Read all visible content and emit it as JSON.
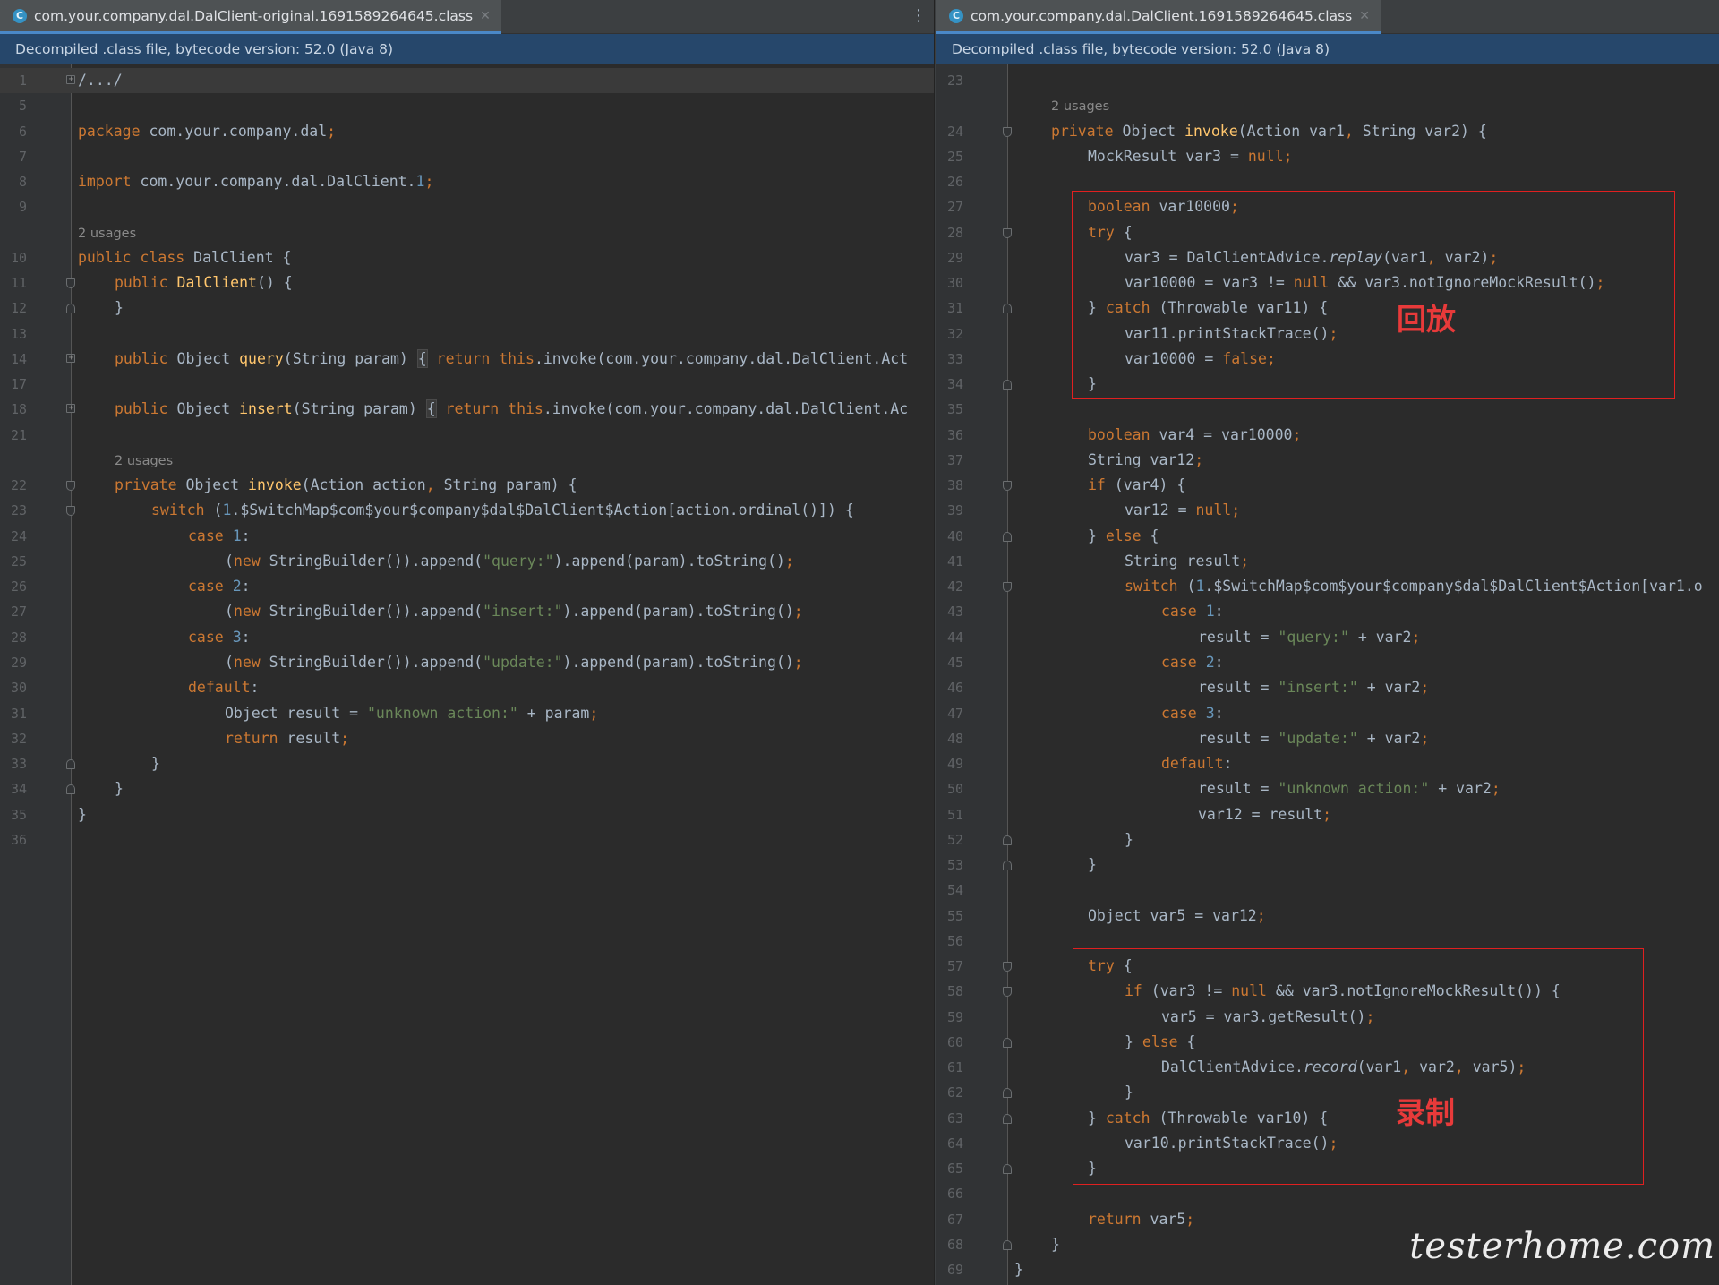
{
  "left": {
    "tab": {
      "title": "com.your.company.dal.DalClient-original.1691589264645.class",
      "icon": "C"
    },
    "banner": "Decompiled .class file, bytecode version: 52.0 (Java 8)"
  },
  "right": {
    "tab": {
      "title": "com.your.company.dal.DalClient.1691589264645.class",
      "icon": "C"
    },
    "banner": "Decompiled .class file, bytecode version: 52.0 (Java 8)"
  },
  "annotations": {
    "replay": "回放",
    "record": "录制"
  },
  "watermark": "testerhome.com",
  "colors": {
    "keyword": "#cc7832",
    "string": "#6a8759",
    "number": "#6897bb",
    "method": "#ffc66d",
    "annotation_box": "#e02020"
  },
  "icons": {
    "tab_icon": "class-icon",
    "close": "close-icon",
    "menu": "more-vertical-icon",
    "fold": "fold-marker-icon"
  },
  "left_lines": [
    {
      "n": "1",
      "indent": 0,
      "fold": "plus",
      "tokens": [
        [
          "",
          "/.../"
        ]
      ]
    },
    {
      "n": "5",
      "indent": 0,
      "tokens": []
    },
    {
      "n": "6",
      "indent": 0,
      "tokens": [
        [
          "kw",
          "package"
        ],
        [
          "plain",
          " com.your.company.dal"
        ],
        [
          "kw",
          ";"
        ]
      ]
    },
    {
      "n": "7",
      "indent": 0,
      "tokens": []
    },
    {
      "n": "8",
      "indent": 0,
      "tokens": [
        [
          "kw",
          "import"
        ],
        [
          "plain",
          " com.your.company.dal.DalClient."
        ],
        [
          "num",
          "1"
        ],
        [
          "kw",
          ";"
        ]
      ]
    },
    {
      "n": "9",
      "indent": 0,
      "tokens": []
    },
    {
      "n": "",
      "indent": 0,
      "hint": "2 usages"
    },
    {
      "n": "10",
      "indent": 0,
      "tokens": [
        [
          "kw",
          "public class"
        ],
        [
          "plain",
          " DalClient {"
        ]
      ]
    },
    {
      "n": "11",
      "indent": 1,
      "fold": "start",
      "tokens": [
        [
          "kw",
          "public"
        ],
        [
          "plain",
          " "
        ],
        [
          "fn",
          "DalClient"
        ],
        [
          "plain",
          "() {"
        ]
      ]
    },
    {
      "n": "12",
      "indent": 1,
      "fold": "end",
      "tokens": [
        [
          "plain",
          "}"
        ]
      ]
    },
    {
      "n": "13",
      "indent": 0,
      "tokens": []
    },
    {
      "n": "14",
      "indent": 1,
      "fold": "plus",
      "tokens": [
        [
          "kw",
          "public"
        ],
        [
          "plain",
          " Object "
        ],
        [
          "fn",
          "query"
        ],
        [
          "plain",
          "(String param) "
        ],
        [
          "box",
          "{"
        ],
        [
          "plain",
          " "
        ],
        [
          "kw",
          "return this"
        ],
        [
          "plain",
          ".invoke(com.your.company.dal.DalClient.Act"
        ]
      ]
    },
    {
      "n": "17",
      "indent": 0,
      "tokens": []
    },
    {
      "n": "18",
      "indent": 1,
      "fold": "plus",
      "tokens": [
        [
          "kw",
          "public"
        ],
        [
          "plain",
          " Object "
        ],
        [
          "fn",
          "insert"
        ],
        [
          "plain",
          "(String param) "
        ],
        [
          "box",
          "{"
        ],
        [
          "plain",
          " "
        ],
        [
          "kw",
          "return this"
        ],
        [
          "plain",
          ".invoke(com.your.company.dal.DalClient.Ac"
        ]
      ]
    },
    {
      "n": "21",
      "indent": 0,
      "tokens": []
    },
    {
      "n": "",
      "indent": 1,
      "hint": "2 usages"
    },
    {
      "n": "22",
      "indent": 1,
      "fold": "start",
      "tokens": [
        [
          "kw",
          "private"
        ],
        [
          "plain",
          " Object "
        ],
        [
          "fn",
          "invoke"
        ],
        [
          "plain",
          "(Action action"
        ],
        [
          "kw",
          ","
        ],
        [
          "plain",
          " String param) {"
        ]
      ]
    },
    {
      "n": "23",
      "indent": 2,
      "fold": "start",
      "tokens": [
        [
          "kw",
          "switch"
        ],
        [
          "plain",
          " ("
        ],
        [
          "num",
          "1"
        ],
        [
          "plain",
          ".$SwitchMap$com$your$company$dal$DalClient$Action[action.ordinal()]) {"
        ]
      ]
    },
    {
      "n": "24",
      "indent": 3,
      "tokens": [
        [
          "kw",
          "case"
        ],
        [
          "plain",
          " "
        ],
        [
          "num",
          "1"
        ],
        [
          "plain",
          ":"
        ]
      ]
    },
    {
      "n": "25",
      "indent": 4,
      "tokens": [
        [
          "plain",
          "("
        ],
        [
          "kw",
          "new"
        ],
        [
          "plain",
          " StringBuilder()).append("
        ],
        [
          "str",
          "\"query:\""
        ],
        [
          "plain",
          ").append(param).toString()"
        ],
        [
          "kw",
          ";"
        ]
      ]
    },
    {
      "n": "26",
      "indent": 3,
      "tokens": [
        [
          "kw",
          "case"
        ],
        [
          "plain",
          " "
        ],
        [
          "num",
          "2"
        ],
        [
          "plain",
          ":"
        ]
      ]
    },
    {
      "n": "27",
      "indent": 4,
      "tokens": [
        [
          "plain",
          "("
        ],
        [
          "kw",
          "new"
        ],
        [
          "plain",
          " StringBuilder()).append("
        ],
        [
          "str",
          "\"insert:\""
        ],
        [
          "plain",
          ").append(param).toString()"
        ],
        [
          "kw",
          ";"
        ]
      ]
    },
    {
      "n": "28",
      "indent": 3,
      "tokens": [
        [
          "kw",
          "case"
        ],
        [
          "plain",
          " "
        ],
        [
          "num",
          "3"
        ],
        [
          "plain",
          ":"
        ]
      ]
    },
    {
      "n": "29",
      "indent": 4,
      "tokens": [
        [
          "plain",
          "("
        ],
        [
          "kw",
          "new"
        ],
        [
          "plain",
          " StringBuilder()).append("
        ],
        [
          "str",
          "\"update:\""
        ],
        [
          "plain",
          ").append(param).toString()"
        ],
        [
          "kw",
          ";"
        ]
      ]
    },
    {
      "n": "30",
      "indent": 3,
      "tokens": [
        [
          "kw",
          "default"
        ],
        [
          "plain",
          ":"
        ]
      ]
    },
    {
      "n": "31",
      "indent": 4,
      "tokens": [
        [
          "plain",
          "Object result = "
        ],
        [
          "str",
          "\"unknown action:\""
        ],
        [
          "plain",
          " + param"
        ],
        [
          "kw",
          ";"
        ]
      ]
    },
    {
      "n": "32",
      "indent": 4,
      "tokens": [
        [
          "kw",
          "return"
        ],
        [
          "plain",
          " result"
        ],
        [
          "kw",
          ";"
        ]
      ]
    },
    {
      "n": "33",
      "indent": 2,
      "fold": "end",
      "tokens": [
        [
          "plain",
          "}"
        ]
      ]
    },
    {
      "n": "34",
      "indent": 1,
      "fold": "end",
      "tokens": [
        [
          "plain",
          "}"
        ]
      ]
    },
    {
      "n": "35",
      "indent": 0,
      "tokens": [
        [
          "plain",
          "}"
        ]
      ]
    },
    {
      "n": "36",
      "indent": 0,
      "tokens": []
    }
  ],
  "right_lines": [
    {
      "n": "23",
      "indent": 0,
      "tokens": []
    },
    {
      "n": "",
      "indent": 1,
      "hint": "2 usages"
    },
    {
      "n": "24",
      "indent": 1,
      "fold": "start",
      "tokens": [
        [
          "kw",
          "private"
        ],
        [
          "plain",
          " Object "
        ],
        [
          "fn",
          "invoke"
        ],
        [
          "plain",
          "(Action var1"
        ],
        [
          "kw",
          ","
        ],
        [
          "plain",
          " String var2) {"
        ]
      ]
    },
    {
      "n": "25",
      "indent": 2,
      "tokens": [
        [
          "plain",
          "MockResult var3 = "
        ],
        [
          "kw",
          "null;"
        ]
      ]
    },
    {
      "n": "26",
      "indent": 0,
      "tokens": []
    },
    {
      "n": "27",
      "indent": 2,
      "tokens": [
        [
          "kw",
          "boolean"
        ],
        [
          "plain",
          " var10000"
        ],
        [
          "kw",
          ";"
        ]
      ]
    },
    {
      "n": "28",
      "indent": 2,
      "fold": "start",
      "tokens": [
        [
          "kw",
          "try"
        ],
        [
          "plain",
          " {"
        ]
      ]
    },
    {
      "n": "29",
      "indent": 3,
      "tokens": [
        [
          "plain",
          "var3 = DalClientAdvice."
        ],
        [
          "it",
          "replay"
        ],
        [
          "plain",
          "(var1"
        ],
        [
          "kw",
          ","
        ],
        [
          "plain",
          " var2)"
        ],
        [
          "kw",
          ";"
        ]
      ]
    },
    {
      "n": "30",
      "indent": 3,
      "tokens": [
        [
          "plain",
          "var10000 = var3 != "
        ],
        [
          "kw",
          "null"
        ],
        [
          "plain",
          " && var3.notIgnoreMockResult()"
        ],
        [
          "kw",
          ";"
        ]
      ]
    },
    {
      "n": "31",
      "indent": 2,
      "fold": "end",
      "tokens": [
        [
          "plain",
          "} "
        ],
        [
          "kw",
          "catch"
        ],
        [
          "plain",
          " (Throwable var11) {"
        ]
      ]
    },
    {
      "n": "32",
      "indent": 3,
      "tokens": [
        [
          "plain",
          "var11.printStackTrace()"
        ],
        [
          "kw",
          ";"
        ]
      ]
    },
    {
      "n": "33",
      "indent": 3,
      "tokens": [
        [
          "plain",
          "var10000 = "
        ],
        [
          "kw",
          "false;"
        ]
      ]
    },
    {
      "n": "34",
      "indent": 2,
      "fold": "end",
      "tokens": [
        [
          "plain",
          "}"
        ]
      ]
    },
    {
      "n": "35",
      "indent": 0,
      "tokens": []
    },
    {
      "n": "36",
      "indent": 2,
      "tokens": [
        [
          "kw",
          "boolean"
        ],
        [
          "plain",
          " var4 = var10000"
        ],
        [
          "kw",
          ";"
        ]
      ]
    },
    {
      "n": "37",
      "indent": 2,
      "tokens": [
        [
          "plain",
          "String var12"
        ],
        [
          "kw",
          ";"
        ]
      ]
    },
    {
      "n": "38",
      "indent": 2,
      "fold": "start",
      "tokens": [
        [
          "kw",
          "if"
        ],
        [
          "plain",
          " (var4) {"
        ]
      ]
    },
    {
      "n": "39",
      "indent": 3,
      "tokens": [
        [
          "plain",
          "var12 = "
        ],
        [
          "kw",
          "null;"
        ]
      ]
    },
    {
      "n": "40",
      "indent": 2,
      "fold": "end",
      "tokens": [
        [
          "plain",
          "} "
        ],
        [
          "kw",
          "else"
        ],
        [
          "plain",
          " {"
        ]
      ]
    },
    {
      "n": "41",
      "indent": 3,
      "tokens": [
        [
          "plain",
          "String result"
        ],
        [
          "kw",
          ";"
        ]
      ]
    },
    {
      "n": "42",
      "indent": 3,
      "fold": "start",
      "tokens": [
        [
          "kw",
          "switch"
        ],
        [
          "plain",
          " ("
        ],
        [
          "num",
          "1"
        ],
        [
          "plain",
          ".$SwitchMap$com$your$company$dal$DalClient$Action[var1.o"
        ]
      ]
    },
    {
      "n": "43",
      "indent": 4,
      "tokens": [
        [
          "kw",
          "case"
        ],
        [
          "plain",
          " "
        ],
        [
          "num",
          "1"
        ],
        [
          "plain",
          ":"
        ]
      ]
    },
    {
      "n": "44",
      "indent": 5,
      "tokens": [
        [
          "plain",
          "result = "
        ],
        [
          "str",
          "\"query:\""
        ],
        [
          "plain",
          " + var2"
        ],
        [
          "kw",
          ";"
        ]
      ]
    },
    {
      "n": "45",
      "indent": 4,
      "tokens": [
        [
          "kw",
          "case"
        ],
        [
          "plain",
          " "
        ],
        [
          "num",
          "2"
        ],
        [
          "plain",
          ":"
        ]
      ]
    },
    {
      "n": "46",
      "indent": 5,
      "tokens": [
        [
          "plain",
          "result = "
        ],
        [
          "str",
          "\"insert:\""
        ],
        [
          "plain",
          " + var2"
        ],
        [
          "kw",
          ";"
        ]
      ]
    },
    {
      "n": "47",
      "indent": 4,
      "tokens": [
        [
          "kw",
          "case"
        ],
        [
          "plain",
          " "
        ],
        [
          "num",
          "3"
        ],
        [
          "plain",
          ":"
        ]
      ]
    },
    {
      "n": "48",
      "indent": 5,
      "tokens": [
        [
          "plain",
          "result = "
        ],
        [
          "str",
          "\"update:\""
        ],
        [
          "plain",
          " + var2"
        ],
        [
          "kw",
          ";"
        ]
      ]
    },
    {
      "n": "49",
      "indent": 4,
      "tokens": [
        [
          "kw",
          "default"
        ],
        [
          "plain",
          ":"
        ]
      ]
    },
    {
      "n": "50",
      "indent": 5,
      "tokens": [
        [
          "plain",
          "result = "
        ],
        [
          "str",
          "\"unknown action:\""
        ],
        [
          "plain",
          " + var2"
        ],
        [
          "kw",
          ";"
        ]
      ]
    },
    {
      "n": "51",
      "indent": 5,
      "tokens": [
        [
          "plain",
          "var12 = result"
        ],
        [
          "kw",
          ";"
        ]
      ]
    },
    {
      "n": "52",
      "indent": 3,
      "fold": "end",
      "tokens": [
        [
          "plain",
          "}"
        ]
      ]
    },
    {
      "n": "53",
      "indent": 2,
      "fold": "end",
      "tokens": [
        [
          "plain",
          "}"
        ]
      ]
    },
    {
      "n": "54",
      "indent": 0,
      "tokens": []
    },
    {
      "n": "55",
      "indent": 2,
      "tokens": [
        [
          "plain",
          "Object var5 = var12"
        ],
        [
          "kw",
          ";"
        ]
      ]
    },
    {
      "n": "56",
      "indent": 0,
      "tokens": []
    },
    {
      "n": "57",
      "indent": 2,
      "fold": "start",
      "tokens": [
        [
          "kw",
          "try"
        ],
        [
          "plain",
          " {"
        ]
      ]
    },
    {
      "n": "58",
      "indent": 3,
      "fold": "start",
      "tokens": [
        [
          "kw",
          "if"
        ],
        [
          "plain",
          " (var3 != "
        ],
        [
          "kw",
          "null"
        ],
        [
          "plain",
          " && var3.notIgnoreMockResult()) {"
        ]
      ]
    },
    {
      "n": "59",
      "indent": 4,
      "tokens": [
        [
          "plain",
          "var5 = var3.getResult()"
        ],
        [
          "kw",
          ";"
        ]
      ]
    },
    {
      "n": "60",
      "indent": 3,
      "fold": "end",
      "tokens": [
        [
          "plain",
          "} "
        ],
        [
          "kw",
          "else"
        ],
        [
          "plain",
          " {"
        ]
      ]
    },
    {
      "n": "61",
      "indent": 4,
      "tokens": [
        [
          "plain",
          "DalClientAdvice."
        ],
        [
          "it",
          "record"
        ],
        [
          "plain",
          "(var1"
        ],
        [
          "kw",
          ","
        ],
        [
          "plain",
          " var2"
        ],
        [
          "kw",
          ","
        ],
        [
          "plain",
          " var5)"
        ],
        [
          "kw",
          ";"
        ]
      ]
    },
    {
      "n": "62",
      "indent": 3,
      "fold": "end",
      "tokens": [
        [
          "plain",
          "}"
        ]
      ]
    },
    {
      "n": "63",
      "indent": 2,
      "fold": "end",
      "tokens": [
        [
          "plain",
          "} "
        ],
        [
          "kw",
          "catch"
        ],
        [
          "plain",
          " (Throwable var10) {"
        ]
      ]
    },
    {
      "n": "64",
      "indent": 3,
      "tokens": [
        [
          "plain",
          "var10.printStackTrace()"
        ],
        [
          "kw",
          ";"
        ]
      ]
    },
    {
      "n": "65",
      "indent": 2,
      "fold": "end",
      "tokens": [
        [
          "plain",
          "}"
        ]
      ]
    },
    {
      "n": "66",
      "indent": 0,
      "tokens": []
    },
    {
      "n": "67",
      "indent": 2,
      "tokens": [
        [
          "kw",
          "return"
        ],
        [
          "plain",
          " var5"
        ],
        [
          "kw",
          ";"
        ]
      ]
    },
    {
      "n": "68",
      "indent": 1,
      "fold": "end",
      "tokens": [
        [
          "plain",
          "}"
        ]
      ]
    },
    {
      "n": "69",
      "indent": 0,
      "tokens": [
        [
          "plain",
          "}"
        ]
      ]
    }
  ]
}
